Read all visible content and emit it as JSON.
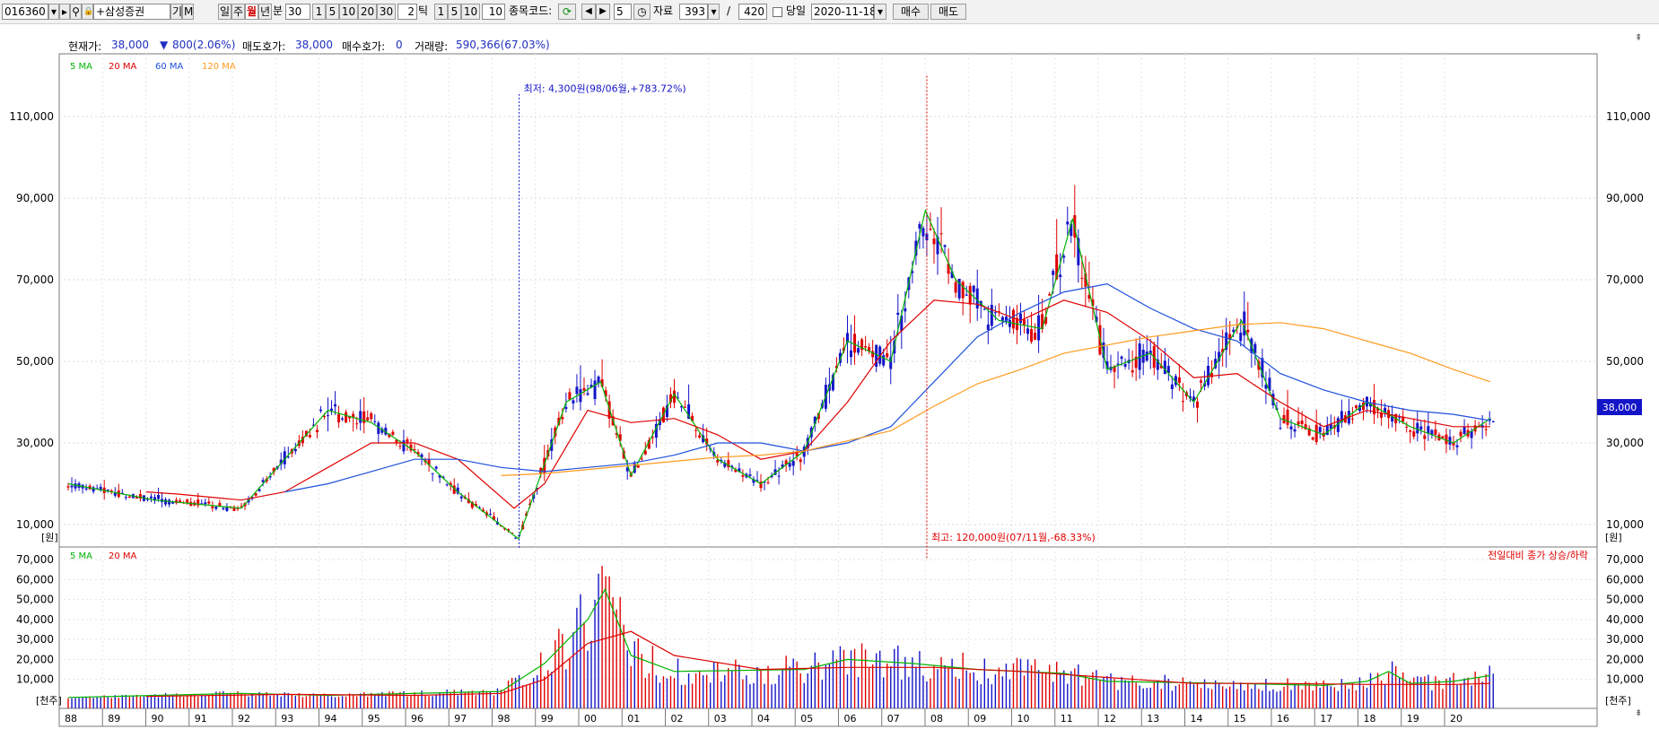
{
  "toolbar": {
    "code": "016360",
    "name": "+삼성증권",
    "ki": "기",
    "m": "M",
    "periods": [
      "일",
      "주",
      "월",
      "년"
    ],
    "active_period": "월",
    "min_label": "분",
    "min_value": "30",
    "min_presets": [
      "1",
      "5",
      "10",
      "20",
      "30"
    ],
    "tick_value": "2",
    "tick_label": "틱",
    "tick_presets": [
      "1",
      "5",
      "10"
    ],
    "tick_count": "10",
    "stock_code_label": "종목코드:",
    "step_value": "5",
    "data_label": "자료",
    "data_count": "393",
    "slash": "/",
    "data_total": "420",
    "today_label": "당일",
    "date": "2020-11-18",
    "buy_label": "매수",
    "sell_label": "매도"
  },
  "info": {
    "price_label": "현재가:",
    "price": "38,000",
    "change": "800(2.06%)",
    "ask_label": "매도호가:",
    "ask": "38,000",
    "bid_label": "매수호가:",
    "bid": "0",
    "volume_label": "거래량:",
    "volume": "590,366(67.03%)"
  },
  "price_legend": [
    "5 MA",
    "20 MA",
    "60 MA",
    "120 MA"
  ],
  "volume_legend": [
    "5 MA",
    "20 MA"
  ],
  "annotations": {
    "low": "최저: 4,300원(98/06월,+783.72%)",
    "high": "최고: 120,000원(07/11월,-68.33%)"
  },
  "price_unit": "[원]",
  "volume_unit": "[천주]",
  "volume_note": "전일대비 종가 상승/하락",
  "current_price_tag": "38,000",
  "colors": {
    "up": "#e00000",
    "down": "#1414c8",
    "ma5": "#00b400",
    "ma20": "#e00000",
    "ma60": "#1e50dc",
    "ma120": "#ff9a1e"
  },
  "chart_data": [
    {
      "type": "candlestick",
      "title": "",
      "x_ticks": [
        "88",
        "89",
        "90",
        "91",
        "92",
        "93",
        "94",
        "95",
        "96",
        "97",
        "98",
        "99",
        "00",
        "01",
        "02",
        "03",
        "04",
        "05",
        "06",
        "07",
        "08",
        "09",
        "10",
        "11",
        "12",
        "13",
        "14",
        "15",
        "16",
        "17",
        "18",
        "19",
        "20"
      ],
      "y_ticks": [
        "10,000",
        "30,000",
        "50,000",
        "70,000",
        "90,000",
        "110,000"
      ],
      "ylim": [
        5000,
        121000
      ],
      "series": [
        {
          "name": "5 MA",
          "x": [
            1988,
            1990,
            1992,
            1994,
            1995,
            1996,
            1997,
            1998.4,
            1999.5,
            2000.3,
            2001,
            2002,
            2003,
            2004,
            2005,
            2006,
            2007,
            2007.8,
            2008.5,
            2009.5,
            2010.5,
            2011.2,
            2012,
            2013,
            2014,
            2015.1,
            2016,
            2017,
            2018,
            2019,
            2020,
            2020.85
          ],
          "y": [
            20000,
            16000,
            14000,
            38000,
            35000,
            28000,
            18000,
            6500,
            40000,
            45000,
            22000,
            42000,
            26000,
            20000,
            28000,
            55000,
            50000,
            87000,
            70000,
            60000,
            58000,
            85000,
            48000,
            52000,
            40000,
            60000,
            36000,
            32000,
            40000,
            34000,
            30000,
            36000
          ]
        },
        {
          "name": "20 MA",
          "x": [
            1989.8,
            1990.5,
            1992,
            1993,
            1994,
            1995,
            1996,
            1997,
            1998.3,
            1999,
            2000,
            2001,
            2002,
            2003,
            2004,
            2005,
            2006,
            2007,
            2008,
            2009,
            2010,
            2011,
            2012,
            2013,
            2014,
            2015,
            2016,
            2017,
            2018,
            2019,
            2020,
            2020.85
          ],
          "y": [
            18000,
            17500,
            16000,
            18000,
            24000,
            30000,
            30000,
            26000,
            14000,
            20000,
            38000,
            35000,
            36000,
            32000,
            26000,
            28000,
            40000,
            55000,
            65000,
            64000,
            60000,
            65000,
            62000,
            55000,
            46000,
            47000,
            40000,
            34000,
            38000,
            36000,
            34000,
            34000
          ]
        },
        {
          "name": "60 MA",
          "x": [
            1993,
            1994,
            1995,
            1996,
            1997,
            1998,
            1999,
            2000,
            2001,
            2002,
            2003,
            2004,
            2005,
            2006,
            2007,
            2008,
            2009,
            2010,
            2011,
            2012,
            2013,
            2014,
            2015,
            2016,
            2017,
            2018,
            2019,
            2020,
            2020.85
          ],
          "y": [
            18000,
            20000,
            23000,
            26000,
            26000,
            24000,
            23000,
            24000,
            25000,
            27000,
            30000,
            30000,
            28000,
            30000,
            34000,
            45000,
            56000,
            62000,
            67000,
            69000,
            63000,
            58000,
            55000,
            47000,
            43000,
            40000,
            38000,
            37000,
            35500
          ]
        },
        {
          "name": "120 MA",
          "x": [
            1998,
            1999,
            2000,
            2001,
            2002,
            2003,
            2004,
            2005,
            2006,
            2007,
            2008,
            2009,
            2010,
            2011,
            2012,
            2013,
            2014,
            2015,
            2016,
            2017,
            2018,
            2019,
            2020,
            2020.85
          ],
          "y": [
            22000,
            22500,
            23500,
            24500,
            25500,
            26500,
            27000,
            28000,
            30500,
            33000,
            39000,
            44500,
            48000,
            52000,
            54000,
            56000,
            57500,
            59000,
            59500,
            58000,
            55000,
            52000,
            48000,
            45000
          ]
        }
      ],
      "annotations": [
        {
          "text": "최저: 4,300원(98/06월,+783.72%)",
          "x": "1998-06",
          "y": 4300
        },
        {
          "text": "최고: 120,000원(07/11월,-68.33%)",
          "x": "2007-11",
          "y": 120000
        }
      ]
    },
    {
      "type": "bar",
      "title": "",
      "y_ticks": [
        "10,000",
        "20,000",
        "30,000",
        "40,000",
        "50,000",
        "60,000",
        "70,000"
      ],
      "ylim": [
        0,
        75000
      ],
      "series": [
        {
          "name": "5 MA",
          "x": [
            1988,
            1992,
            1994,
            1998,
            1999,
            2000,
            2000.4,
            2001,
            2002,
            2005,
            2006,
            2007.5,
            2009,
            2011,
            2012,
            2015,
            2017,
            2018,
            2018.5,
            2019,
            2020,
            2020.85
          ],
          "y": [
            1000,
            3000,
            2000,
            4000,
            18000,
            40000,
            55000,
            22000,
            14000,
            15000,
            20000,
            18000,
            15000,
            13000,
            9000,
            8000,
            7000,
            9000,
            14000,
            8000,
            9000,
            12000
          ]
        },
        {
          "name": "20 MA",
          "x": [
            1989.8,
            1993,
            1996,
            1998,
            1999,
            2000,
            2001,
            2002,
            2004,
            2006,
            2008,
            2010,
            2012,
            2014,
            2016,
            2018,
            2020,
            2020.85
          ],
          "y": [
            1500,
            2500,
            2000,
            3000,
            10000,
            28000,
            34000,
            22000,
            15000,
            16000,
            16000,
            14000,
            11000,
            8000,
            8000,
            7500,
            7500,
            8000
          ]
        }
      ]
    }
  ]
}
